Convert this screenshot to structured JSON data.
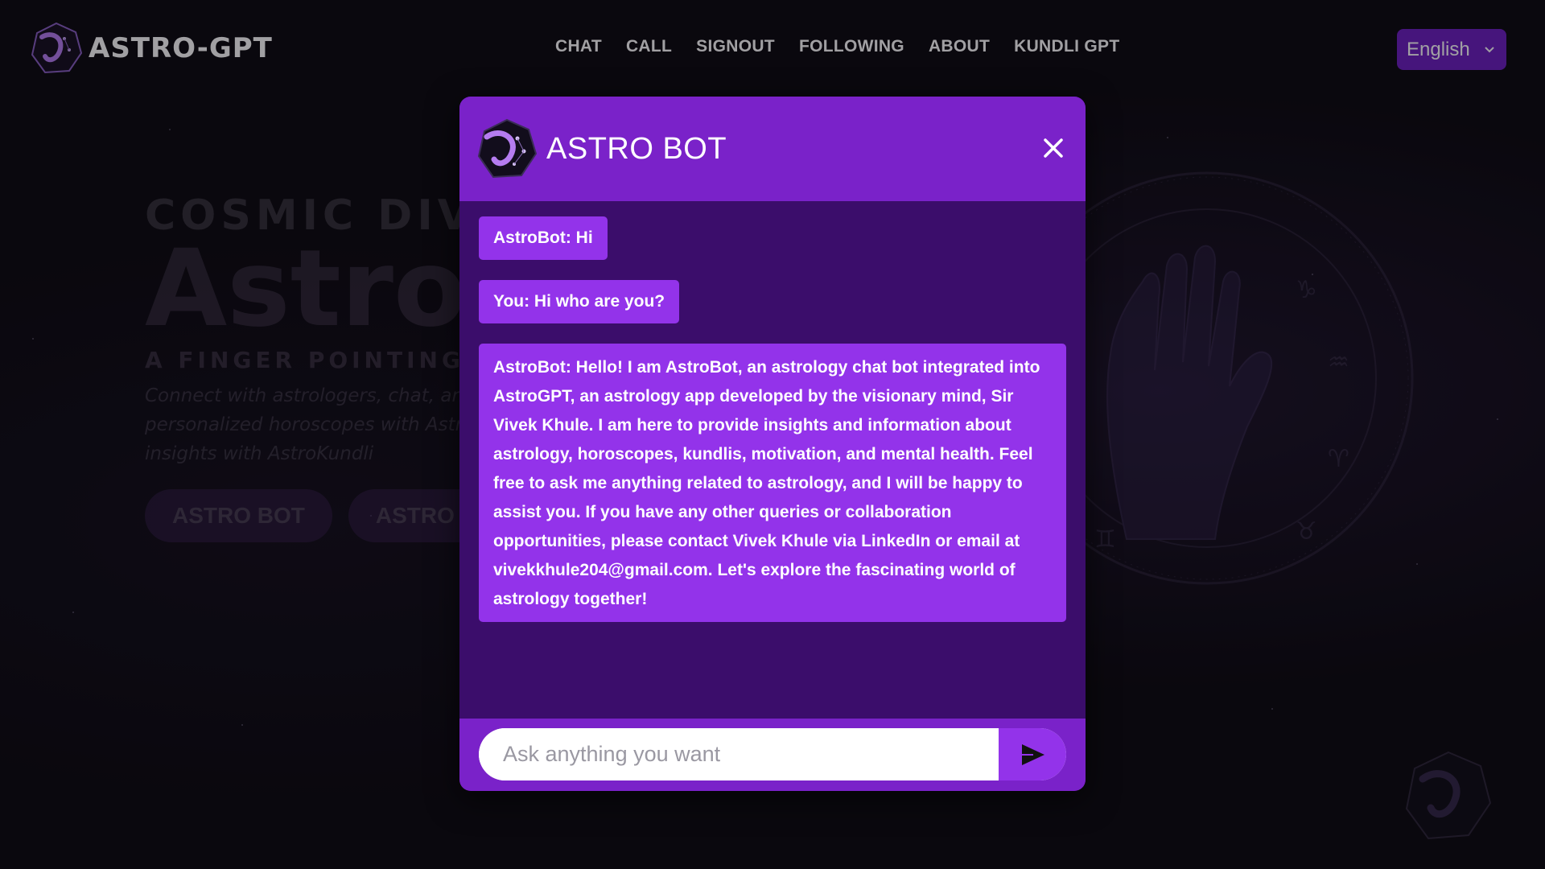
{
  "app": {
    "name": "ASTRO-GPT"
  },
  "nav": {
    "links": [
      "CHAT",
      "CALL",
      "SIGNOUT",
      "FOLLOWING",
      "ABOUT",
      "KUNDLI GPT"
    ],
    "language": "English"
  },
  "hero": {
    "kicker": "COSMIC DIVE",
    "title": "AstroG",
    "tagline": "A FINGER POINTING TO",
    "description_lines": [
      "Connect with astrologers, chat, an",
      "personalized horoscopes with Astro",
      "insights with AstroKundli"
    ],
    "buttons": [
      "ASTRO BOT",
      "ASTRO KU"
    ]
  },
  "chat": {
    "title": "ASTRO BOT",
    "messages": [
      {
        "text": "AstroBot: Hi"
      },
      {
        "text": "You: Hi who are you?"
      },
      {
        "text": "AstroBot: Hello! I am AstroBot, an astrology chat bot integrated into AstroGPT, an astrology app developed by the visionary mind, Sir Vivek Khule. I am here to provide insights and information about astrology, horoscopes, kundlis, motivation, and mental health. Feel free to ask me anything related to astrology, and I will be happy to assist you. If you have any other queries or collaboration opportunities, please contact Vivek Khule via LinkedIn or email at vivekkhule204@gmail.com. Let's explore the fascinating world of astrology together!"
      }
    ],
    "input": {
      "placeholder": "Ask anything you want",
      "value": ""
    }
  },
  "colors": {
    "accent": "#9333ea",
    "header": "#7a22c9",
    "modal_bg": "#3b0d6b",
    "page_bg": "#0c0a0f"
  },
  "icons": {
    "logo": "astro-logo-icon",
    "close": "close-icon",
    "send": "send-icon",
    "language": "chevron-down-icon"
  }
}
